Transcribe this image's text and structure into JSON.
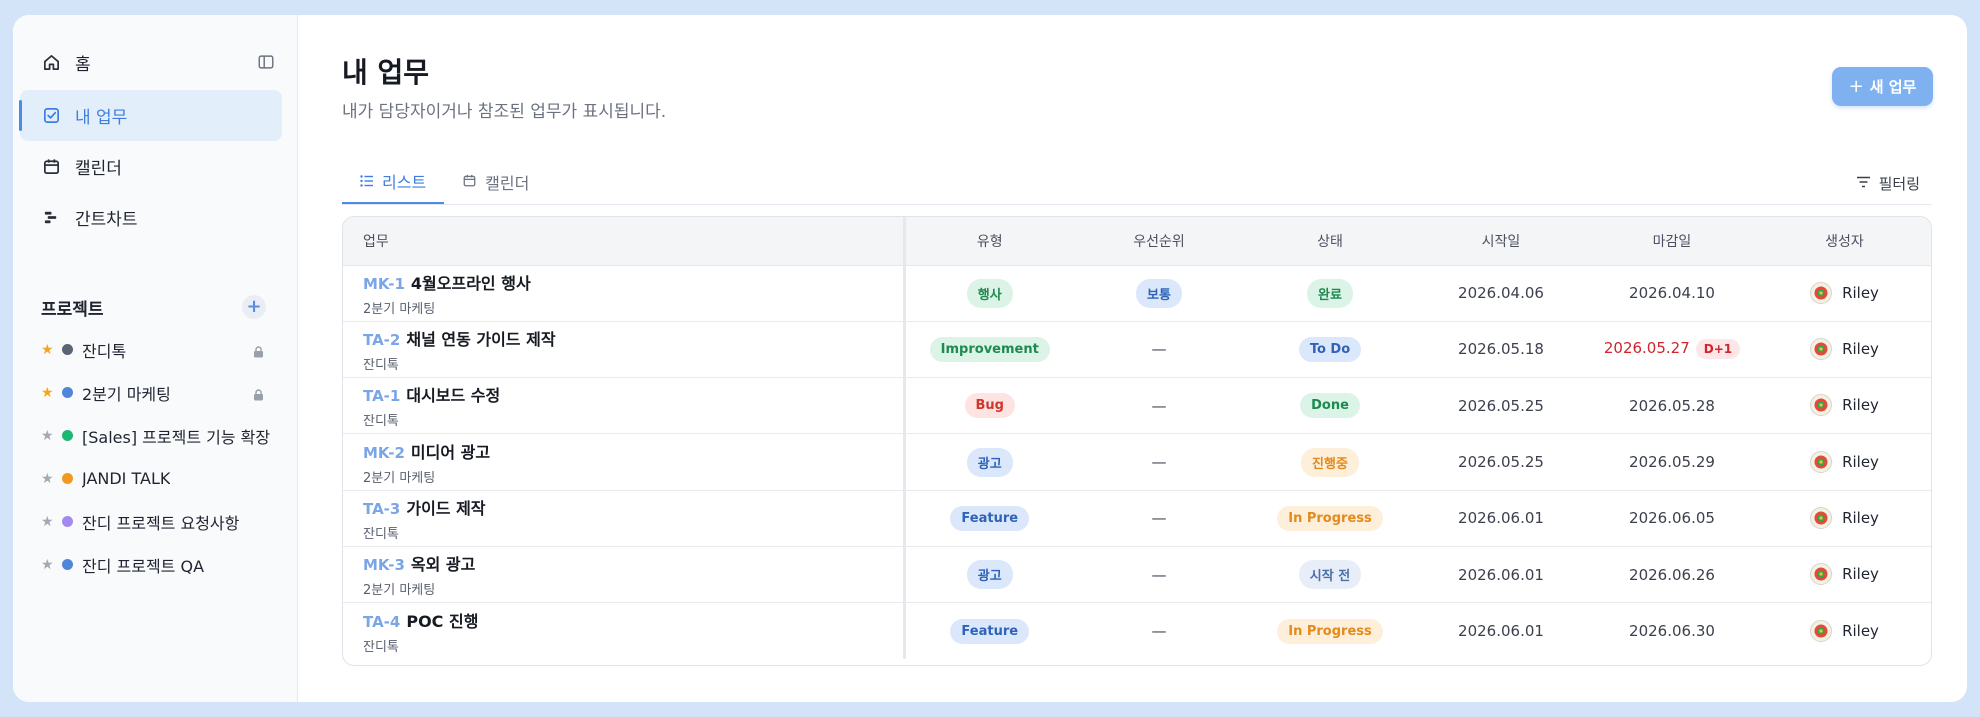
{
  "sidebar": {
    "nav": [
      {
        "label": "홈",
        "icon": "home-icon"
      },
      {
        "label": "내 업무",
        "icon": "checkbox-icon"
      },
      {
        "label": "캘린더",
        "icon": "calendar-icon"
      },
      {
        "label": "간트차트",
        "icon": "gantt-icon"
      }
    ],
    "projects_title": "프로젝트",
    "projects": [
      {
        "name": "잔디톡",
        "starred": true,
        "color": "#5b6472",
        "locked": true
      },
      {
        "name": "2분기 마케팅",
        "starred": true,
        "color": "#4f86d8",
        "locked": true
      },
      {
        "name": "[Sales] 프로젝트 기능 확장",
        "starred": false,
        "color": "#1cb870",
        "locked": false
      },
      {
        "name": "JANDI TALK",
        "starred": false,
        "color": "#ef9a22",
        "locked": false
      },
      {
        "name": "잔디 프로젝트 요청사항",
        "starred": false,
        "color": "#a48af0",
        "locked": false
      },
      {
        "name": "잔디 프로젝트 QA",
        "starred": false,
        "color": "#4f86d8",
        "locked": false
      }
    ]
  },
  "header": {
    "title": "내 업무",
    "subtitle": "내가 담당자이거나 참조된 업무가 표시됩니다.",
    "new_button": "새 업무"
  },
  "tabs": [
    {
      "label": "리스트",
      "icon": "list-icon"
    },
    {
      "label": "캘린더",
      "icon": "calendar-icon"
    }
  ],
  "filter_label": "필터링",
  "table": {
    "columns": [
      "업무",
      "유형",
      "우선순위",
      "상태",
      "시작일",
      "마감일",
      "생성자"
    ],
    "rows": [
      {
        "key": "MK-1",
        "name": "4월오프라인 행사",
        "project": "2분기 마케팅",
        "type": "행사",
        "priority": "보통",
        "status": "완료",
        "start": "2026.04.06",
        "due": "2026.04.10",
        "due_badge": "",
        "creator": "Riley"
      },
      {
        "key": "TA-2",
        "name": "채널 연동 가이드 제작",
        "project": "잔디톡",
        "type": "Improvement",
        "priority": "—",
        "status": "To Do",
        "start": "2026.05.18",
        "due": "2026.05.27",
        "due_badge": "D+1",
        "creator": "Riley"
      },
      {
        "key": "TA-1",
        "name": "대시보드 수정",
        "project": "잔디톡",
        "type": "Bug",
        "priority": "—",
        "status": "Done",
        "start": "2026.05.25",
        "due": "2026.05.28",
        "due_badge": "",
        "creator": "Riley"
      },
      {
        "key": "MK-2",
        "name": "미디어 광고",
        "project": "2분기 마케팅",
        "type": "광고",
        "priority": "—",
        "status": "진행중",
        "start": "2026.05.25",
        "due": "2026.05.29",
        "due_badge": "",
        "creator": "Riley"
      },
      {
        "key": "TA-3",
        "name": "가이드 제작",
        "project": "잔디톡",
        "type": "Feature",
        "priority": "—",
        "status": "In Progress",
        "start": "2026.06.01",
        "due": "2026.06.05",
        "due_badge": "",
        "creator": "Riley"
      },
      {
        "key": "MK-3",
        "name": "옥외 광고",
        "project": "2분기 마케팅",
        "type": "광고",
        "priority": "—",
        "status": "시작 전",
        "start": "2026.06.01",
        "due": "2026.06.26",
        "due_badge": "",
        "creator": "Riley"
      },
      {
        "key": "TA-4",
        "name": "POC 진행",
        "project": "잔디톡",
        "type": "Feature",
        "priority": "—",
        "status": "In Progress",
        "start": "2026.06.01",
        "due": "2026.06.30",
        "due_badge": "",
        "creator": "Riley"
      }
    ]
  },
  "colors": {
    "accent": "#4a8be8",
    "overdue": "#d0242c",
    "badge_green_bg": "#dcf3e7",
    "badge_green_fg": "#1e8a4f",
    "badge_blue_bg": "#dbe8fb",
    "badge_blue_fg": "#2f62b8",
    "badge_red_bg": "#fde4e2",
    "badge_red_fg": "#d0342c",
    "badge_orange_bg": "#fdefd9",
    "badge_orange_fg": "#e48a1c",
    "badge_grey_blue_bg": "#e8eef8",
    "badge_grey_blue_fg": "#4a6fa8"
  }
}
